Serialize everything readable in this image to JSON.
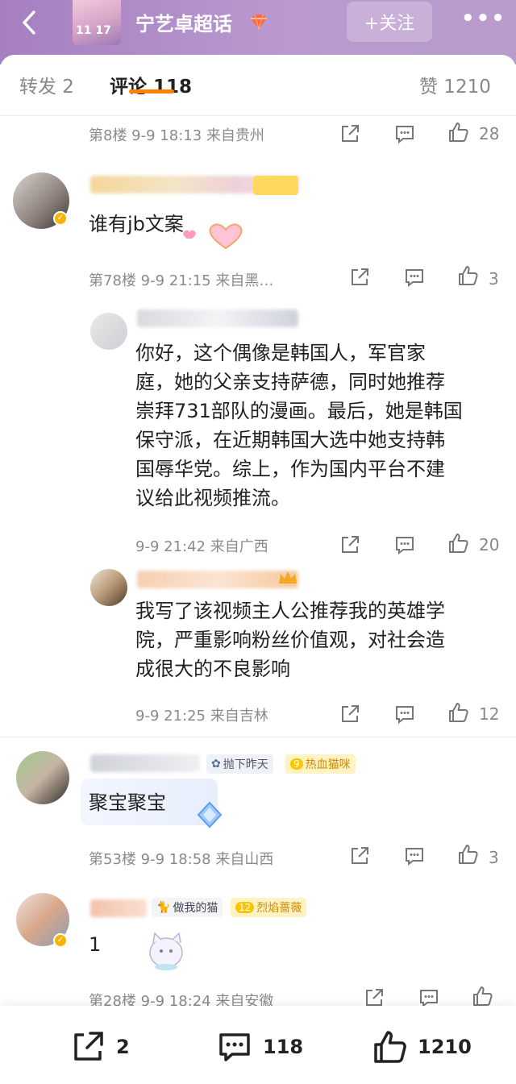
{
  "header": {
    "title": "宁艺卓超话",
    "thumb_date": "11 17",
    "follow_label": "+关注",
    "more_label": "•••"
  },
  "tabs": {
    "repost": "转发 2",
    "comments": "评论 118",
    "likes": "赞 1210"
  },
  "comments": [
    {
      "meta": "第8楼 9-9 18:13 来自贵州",
      "likes": "28"
    },
    {
      "text": "谁有jb文案",
      "meta": "第78楼 9-9 21:15 来自黑…",
      "likes": "3",
      "badge": ""
    },
    {
      "text_lines": [
        "你好，这个偶像是韩国人，军官家",
        "庭，她的父亲支持萨德，同时她推荐",
        "崇拜731部队的漫画。最后，她是韩国",
        "保守派，在近期韩国大选中她支持韩",
        "国辱华党。综上，作为国内平台不建",
        "议给此视频推流。"
      ],
      "meta": "9-9 21:42 来自广西",
      "likes": "20"
    },
    {
      "text_lines": [
        "我写了该视频主人公推荐我的英雄学",
        "院，严重影响粉丝价值观，对社会造",
        "成很大的不良影响"
      ],
      "meta": "9-9 21:25 来自吉林",
      "likes": "12"
    },
    {
      "text": "聚宝聚宝",
      "meta": "第53楼 9-9 18:58 来自山西",
      "likes": "3",
      "tag1": "抛下昨天",
      "tag2": "热血猫咪",
      "tag2_level": "9"
    },
    {
      "text": "1",
      "meta": "第28楼 9-9 18:24 来自安徽",
      "tag1": "做我的猫",
      "tag2": "烈焰蔷薇",
      "tag2_level": "12"
    }
  ],
  "bottom": {
    "repost_count": "2",
    "comment_count": "118",
    "like_count": "1210"
  },
  "colors": {
    "header_gradient_start": "#a57fc0",
    "accent_underline": "#ff8200",
    "badge_gold": "#f7b500"
  }
}
